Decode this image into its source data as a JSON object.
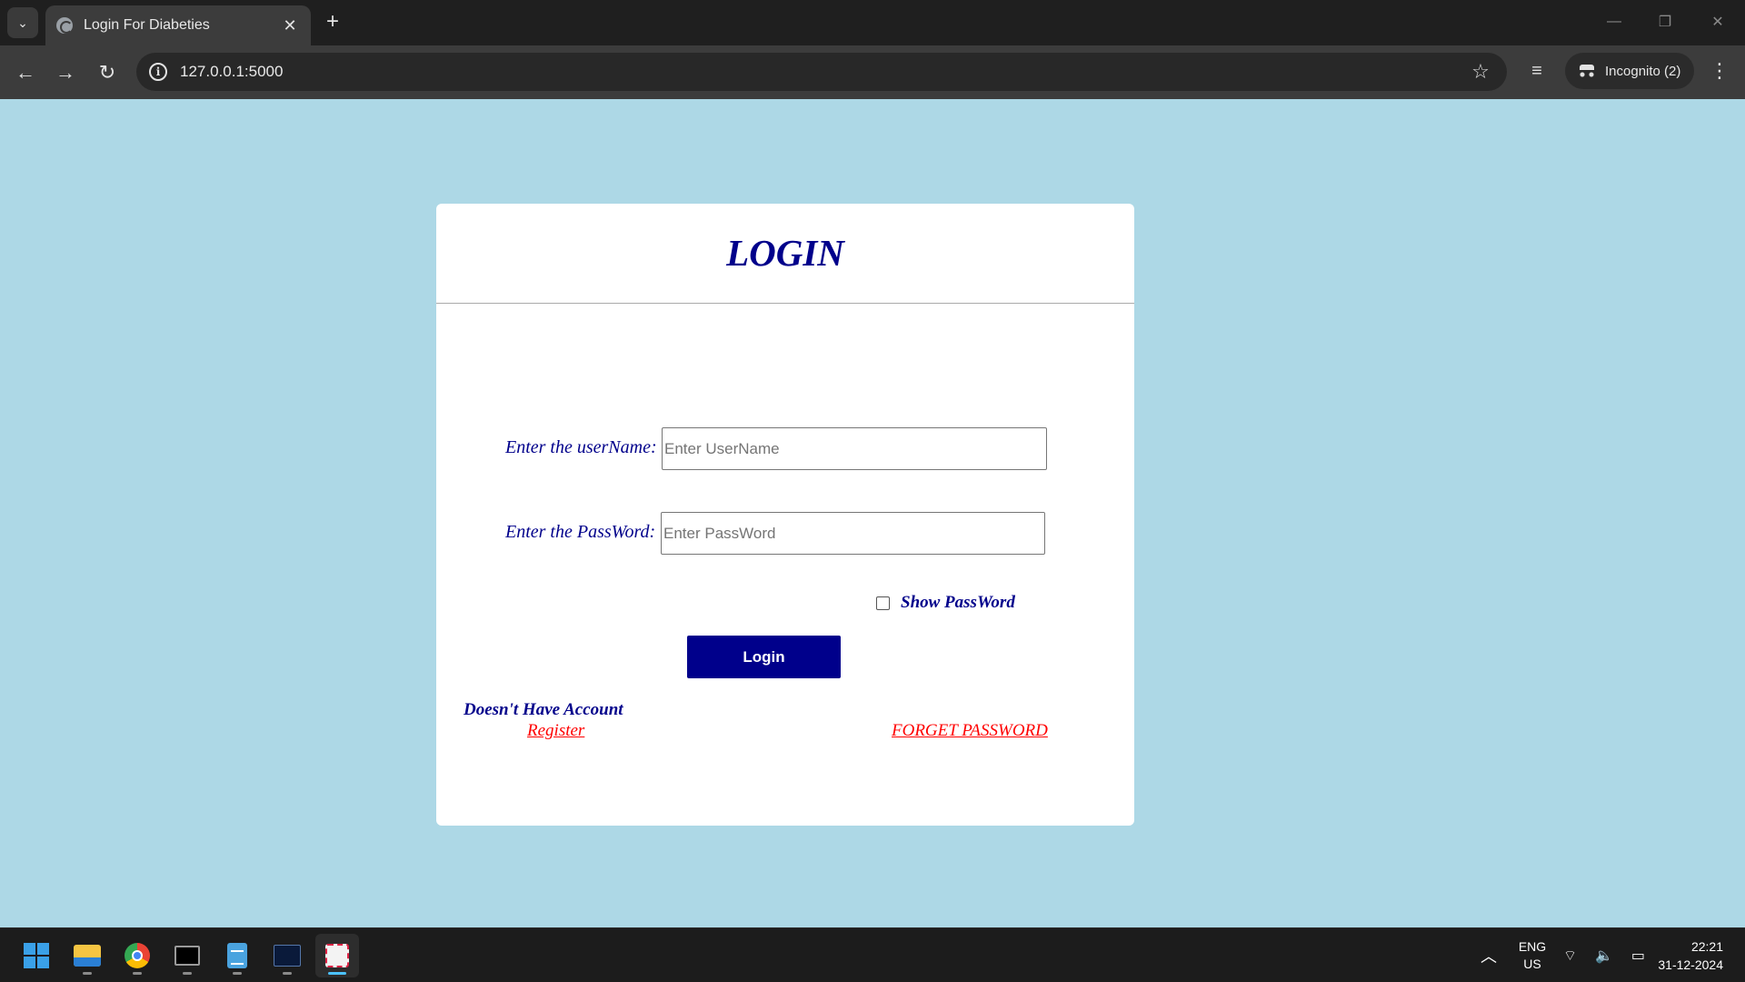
{
  "browser": {
    "tab_title": "Login For Diabeties",
    "tab_close": "✕",
    "new_tab": "+",
    "url": "127.0.0.1:5000",
    "incognito_label": "Incognito (2)",
    "window_controls": {
      "minimize": "—",
      "restore": "❐",
      "close": "✕"
    },
    "nav": {
      "back": "←",
      "forward": "→",
      "reload": "↻",
      "menu": "⋮"
    }
  },
  "login": {
    "title": "LOGIN",
    "username_label": "Enter the userName:",
    "username_placeholder": "Enter UserName",
    "password_label": "Enter the PassWord:",
    "password_placeholder": "Enter PassWord",
    "show_password_label": "Show PassWord",
    "show_password_checked": false,
    "login_button": "Login",
    "no_account_text": "Doesn't Have Account",
    "register_link": "Register",
    "forget_password_link": "FORGET PASSWORD"
  },
  "colors": {
    "page_background": "#add8e6",
    "card_background": "#ffffff",
    "accent": "#00008b",
    "link": "#ff0000"
  },
  "taskbar": {
    "apps": [
      {
        "name": "start",
        "icon": "windows-logo-icon"
      },
      {
        "name": "file-explorer",
        "icon": "folder-icon"
      },
      {
        "name": "chrome",
        "icon": "chrome-icon"
      },
      {
        "name": "terminal",
        "icon": "terminal-icon"
      },
      {
        "name": "notepad",
        "icon": "notepad-icon"
      },
      {
        "name": "mysql-workbench",
        "icon": "mysql-icon"
      },
      {
        "name": "snipping-tool",
        "icon": "snipping-tool-icon",
        "active": true
      }
    ],
    "lang_primary": "ENG",
    "lang_secondary": "US",
    "time": "22:21",
    "date": "31-12-2024"
  }
}
